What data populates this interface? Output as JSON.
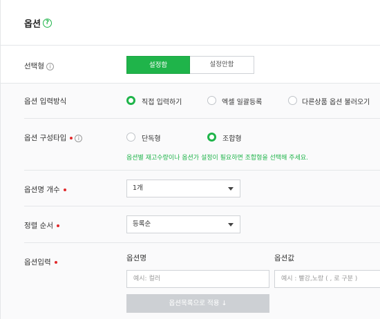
{
  "header": {
    "title": "옵션",
    "help_icon": "question-circle-icon"
  },
  "select_type": {
    "label": "선택형",
    "on_label": "설정함",
    "off_label": "설정안함",
    "selected": "설정함"
  },
  "input_method": {
    "label": "옵션 입력방식",
    "options": [
      "직접 입력하기",
      "엑셀 일괄등록",
      "다른상품 옵션 불러오기"
    ],
    "selected": "직접 입력하기"
  },
  "compose_type": {
    "label": "옵션 구성타입",
    "options": [
      "단독형",
      "조합형"
    ],
    "selected": "조합형",
    "hint": "옵션별 재고수량이나 옵션가 설정이 필요하면 조합형을 선택해 주세요."
  },
  "name_count": {
    "label": "옵션명 개수",
    "value": "1개"
  },
  "sort_order": {
    "label": "정렬 순서",
    "value": "등록순"
  },
  "option_input": {
    "label": "옵션입력",
    "name_header": "옵션명",
    "value_header": "옵션값",
    "name_placeholder": "예시: 컬러",
    "value_placeholder": "예시 : 빨강,노랑 ( , 로 구분 )",
    "apply_label": "옵션목록으로 적용 ↓"
  },
  "colors": {
    "accent": "#1fb44a",
    "required": "#e1292b",
    "disabled": "#cdd0d4"
  }
}
